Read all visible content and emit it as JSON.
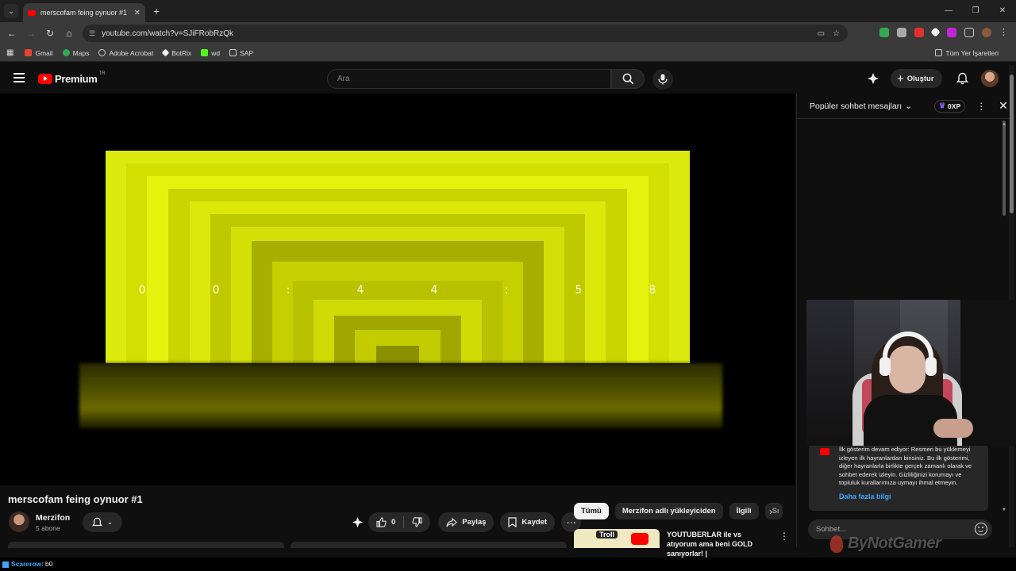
{
  "browser": {
    "tab_title": "merscofam feing oynuor #1 - YouTube",
    "url": "youtube.com/watch?v=SJiFRobRzQk",
    "bookmarks": [
      {
        "label": "Gmail",
        "color": "#ea4335"
      },
      {
        "label": "Maps",
        "color": "#34a853"
      },
      {
        "label": "Adobe Acrobat",
        "color": "#cccccc"
      },
      {
        "label": "BotRix",
        "color": "#eeeeee"
      },
      {
        "label": "wd",
        "color": "#53fc18"
      },
      {
        "label": "SAP",
        "color": "#dddddd"
      }
    ],
    "all_bookmarks_label": "Tüm Yer İşaretleri"
  },
  "youtube": {
    "logo_label": "Premium",
    "region": "TR",
    "search_placeholder": "Ara",
    "create_label": "Oluştur"
  },
  "video": {
    "timer_chars": [
      "0",
      "0",
      ":",
      "4",
      "4",
      ":",
      "5",
      "8"
    ],
    "title": "merscofam feing oynuor #1",
    "channel_name": "Merzifon",
    "subscribers": "5 abone",
    "like_count": "0",
    "share_label": "Paylaş",
    "save_label": "Kaydet"
  },
  "recommendations": {
    "chips": [
      "Tümü",
      "Merzifon adlı yükleyiciden",
      "İlgili",
      "Sı"
    ],
    "first_title": "YOUTUBERLAR ile vs atıyorum ama beni GOLD sanıyorlar! |",
    "first_thumb_text": "Troll"
  },
  "chat": {
    "mode_label": "Popüler sohbet mesajları",
    "xp_label": "0XP",
    "notice_text": "İlk gösterim devam ediyor: Resmen bu yüklemeyi izleyen ilk hayranlardan birisiniz. Bu ilk gösterimi, diğer hayranlarla birlikte gerçek zamanlı olarak ve sohbet ederek izleyin. Gizliliğinizi korumayı ve topluluk kurallarımıza uymayı ihmal etmeyin.",
    "notice_link": "Daha fazla bilgi",
    "input_placeholder": "Sohbet..."
  },
  "overlay": {
    "watermark": "ByNotGamer",
    "bottom_user": "Scarerow",
    "bottom_message": ": b0"
  },
  "colors": {
    "accent_red": "#ff0000",
    "video_yellow": "#d6e200",
    "link_blue": "#3ea6ff"
  }
}
